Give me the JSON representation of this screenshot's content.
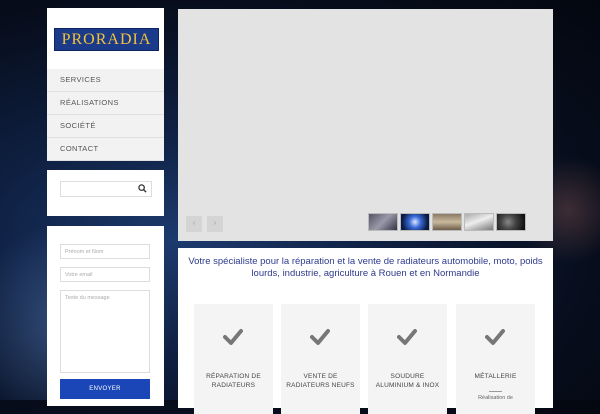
{
  "logo": {
    "text": "PRORADIA"
  },
  "menu": {
    "items": [
      {
        "label": "SERVICES"
      },
      {
        "label": "RÉALISATIONS"
      },
      {
        "label": "SOCIÉTÉ"
      },
      {
        "label": "CONTACT"
      }
    ]
  },
  "search": {
    "placeholder": ""
  },
  "contact_form": {
    "name_placeholder": "Prénom et Nom",
    "email_placeholder": "Votre email",
    "message_placeholder": "Texte du message",
    "send_label": "ENVOYER"
  },
  "slider": {
    "prev": "‹",
    "next": "›",
    "thumbnails": [
      "radiateur-1",
      "radiateur-2",
      "radiateur-3",
      "radiateur-4",
      "radiateur-5"
    ]
  },
  "intro": {
    "tagline": "Votre spécialiste pour la réparation et la vente de radiateurs automobile, moto, poids lourds, industrie, agriculture à Rouen et en Normandie"
  },
  "services": [
    {
      "line1": "RÉPARATION DE",
      "line2": "RADIATEURS",
      "sub": ""
    },
    {
      "line1": "VENTE DE",
      "line2": "RADIATEURS NEUFS",
      "sub": ""
    },
    {
      "line1": "SOUDURE",
      "line2": "ALUMINIUM & INOX",
      "sub": ""
    },
    {
      "line1": "MÉTALLERIE",
      "line2": "",
      "sub": "Réalisation de"
    }
  ],
  "colors": {
    "accent": "#1a46b8",
    "tagline": "#2e3a8c",
    "logo_bg": "#1b3a8a",
    "logo_text": "#f2c33a"
  }
}
